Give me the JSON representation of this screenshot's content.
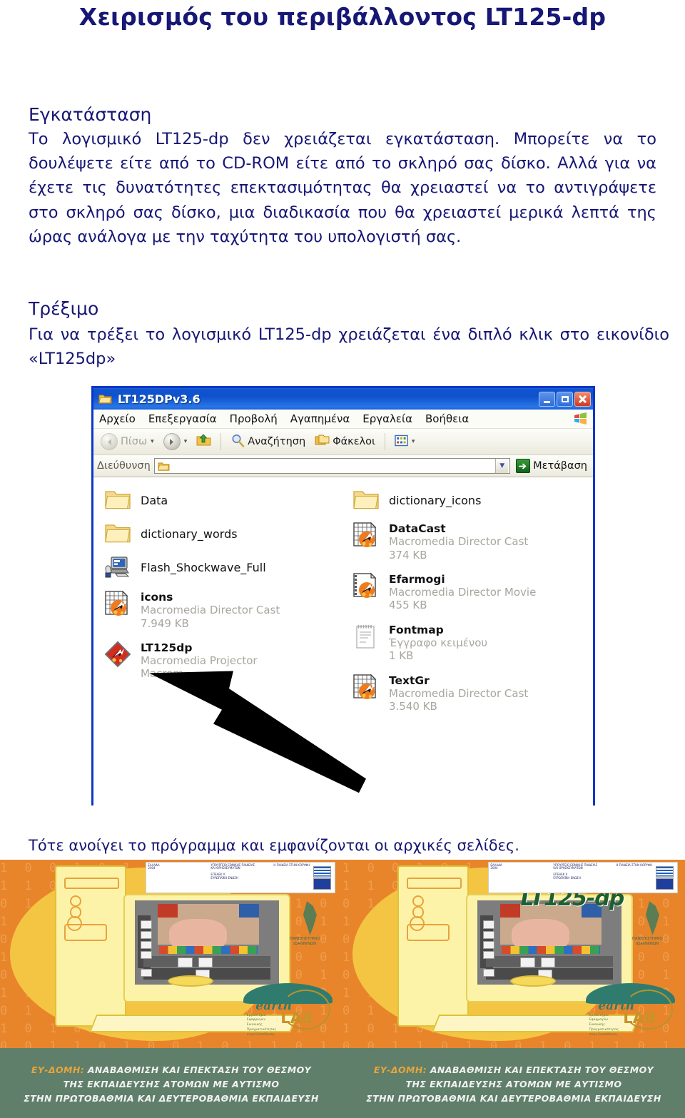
{
  "document": {
    "title": "Χειρισμός του περιβάλλοντος LT125-dp",
    "sections": [
      {
        "heading": "Εγκατάσταση",
        "body": "Το λογισμικό LT125-dp δεν χρειάζεται εγκατάσταση. Μπορείτε να το δουλέψετε είτε από το CD-ROM είτε από το σκληρό σας δίσκο. Αλλά για να έχετε τις δυνατότητες επεκτασιμότητας  θα χρειαστεί να το αντιγράψετε στο σκληρό σας δίσκο, μια διαδικασία που θα χρειαστεί μερικά λεπτά της ώρας ανάλογα με την ταχύτητα του υπολογιστή σας."
      },
      {
        "heading": "Τρέξιμο",
        "body": "Για να τρέξει το λογισμικό LT125-dp χρειάζεται ένα διπλό κλικ στο εικονίδιο «LT125dp»"
      }
    ],
    "caption_after_window": "Τότε ανοίγει το πρόγραμμα και εμφανίζονται οι αρχικές σελίδες.",
    "text_color": "#171775"
  },
  "explorer_window": {
    "title": "LT125DPv3.6",
    "title_icon": "folder-icon",
    "window_buttons": [
      {
        "name": "minimize-button",
        "label": "_"
      },
      {
        "name": "maximize-button",
        "label": "□"
      },
      {
        "name": "close-button",
        "label": "✕"
      }
    ],
    "menu": [
      "Αρχείο",
      "Επεξεργασία",
      "Προβολή",
      "Αγαπημένα",
      "Εργαλεία",
      "Βοήθεια"
    ],
    "toolbar": {
      "back_label": "Πίσω",
      "search_label": "Αναζήτηση",
      "folders_label": "Φάκελοι"
    },
    "address_bar": {
      "label": "Διεύθυνση",
      "value": "",
      "go_label": "Μετάβαση"
    },
    "files_left": [
      {
        "name": "Data",
        "type": "",
        "size": "",
        "icon": "folder-icon"
      },
      {
        "name": "dictionary_words",
        "type": "",
        "size": "",
        "icon": "folder-icon"
      },
      {
        "name": "Flash_Shockwave_Full",
        "type": "",
        "size": "",
        "icon": "application-icon"
      },
      {
        "name": "icons",
        "type": "Macromedia Director Cast",
        "size": "7.949 KB",
        "icon": "director-cast-icon"
      },
      {
        "name": "LT125dp",
        "type": "Macromedia Projector",
        "size": "Macrom",
        "icon": "projector-icon"
      }
    ],
    "files_right": [
      {
        "name": "dictionary_icons",
        "type": "",
        "size": "",
        "icon": "folder-icon"
      },
      {
        "name": "DataCast",
        "type": "Macromedia Director Cast",
        "size": "374 KB",
        "icon": "director-cast-icon"
      },
      {
        "name": "Efarmogi",
        "type": "Macromedia Director Movie",
        "size": "455 KB",
        "icon": "director-movie-icon"
      },
      {
        "name": "Fontmap",
        "type": "Έγγραφο κειμένου",
        "size": "1 KB",
        "icon": "text-document-icon"
      },
      {
        "name": "TextGr",
        "type": "Macromedia Director Cast",
        "size": "3.540 KB",
        "icon": "director-cast-icon"
      }
    ],
    "pointer_annotation": "black-arrow-pointing-to-lt125dp",
    "colors": {
      "titlebar": "#0f52cd",
      "border": "#0a37c8",
      "close": "#cf3a21"
    }
  },
  "splash_screens": [
    {
      "title": "",
      "footer_lines": [
        {
          "highlight": "ΕΥ-ΔΟΜΗ:",
          "rest": " ΑΝΑΒΑΘΜΙΣΗ ΚΑΙ ΕΠΕΚΤΑΣΗ ΤΟΥ ΘΕΣΜΟΥ"
        },
        {
          "highlight": "",
          "rest": "ΤΗΣ ΕΚΠΑΙΔΕΥΣΗΣ ΑΤΟΜΩΝ ΜΕ ΑΥΤΙΣΜΟ"
        },
        {
          "highlight": "",
          "rest": "ΣΤΗΝ ΠΡΩΤΟΒΑΘΜΙΑ ΚΑΙ ΔΕΥΤΕΡΟΒΑΘΜΙΑ ΕΚΠΑΙΔΕΥΣΗ"
        }
      ],
      "logo_earth": "earth",
      "logo_lab": "LAB",
      "university_text": "ΠΑΝΕΠΙΣΤΗΜΙΟ\nΙΩΑΝΝΙΝΩΝ",
      "banner_text": "Η ΠΑΙΔΕΙΑ ΣΤΗΝ ΚΟΡΥΦΗ",
      "background": "#e8852b"
    },
    {
      "title": "LT125-dp",
      "footer_lines": [
        {
          "highlight": "ΕΥ-ΔΟΜΗ:",
          "rest": " ΑΝΑΒΑΘΜΙΣΗ ΚΑΙ ΕΠΕΚΤΑΣΗ ΤΟΥ ΘΕΣΜΟΥ"
        },
        {
          "highlight": "",
          "rest": "ΤΗΣ ΕΚΠΑΙΔΕΥΣΗΣ ΑΤΟΜΩΝ ΜΕ ΑΥΤΙΣΜΟ"
        },
        {
          "highlight": "",
          "rest": "ΣΤΗΝ ΠΡΩΤΟΒΑΘΜΙΑ ΚΑΙ ΔΕΥΤΕΡΟΒΑΘΜΙΑ ΕΚΠΑΙΔΕΥΣΗ"
        }
      ],
      "logo_earth": "earth",
      "logo_lab": "LAB",
      "university_text": "ΠΑΝΕΠΙΣΤΗΜΙΟ\nΙΩΑΝΝΙΝΩΝ",
      "banner_text": "Η ΠΑΙΔΕΙΑ ΣΤΗΝ ΚΟΡΥΦΗ",
      "background": "#e8852b"
    }
  ]
}
